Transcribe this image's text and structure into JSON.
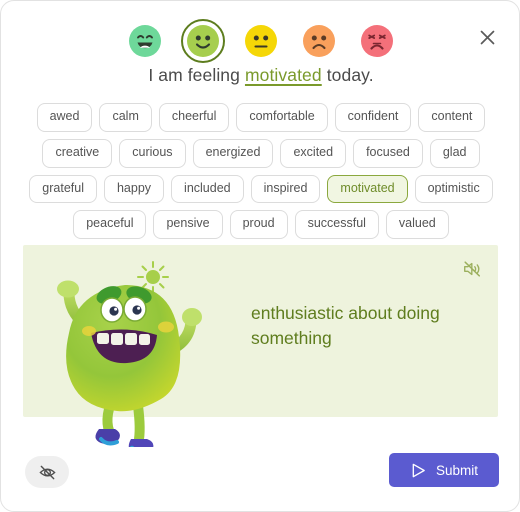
{
  "dialog": {
    "close_icon": "close-icon"
  },
  "mood_scale": {
    "options": [
      {
        "id": "very-happy",
        "icon": "grinning-face-icon",
        "face_color": "#6ed89a",
        "feature_color": "#2f3b2f",
        "selected": false,
        "label": "very happy"
      },
      {
        "id": "happy",
        "icon": "smiling-face-icon",
        "face_color": "#a6ce4e",
        "feature_color": "#2f3b2f",
        "selected": true,
        "label": "happy"
      },
      {
        "id": "neutral",
        "icon": "neutral-face-icon",
        "face_color": "#f5d707",
        "feature_color": "#3a3a28",
        "selected": false,
        "label": "neutral"
      },
      {
        "id": "sad",
        "icon": "frowning-face-icon",
        "face_color": "#f9a05c",
        "feature_color": "#5a3b26",
        "selected": false,
        "label": "sad"
      },
      {
        "id": "angry",
        "icon": "angry-face-icon",
        "face_color": "#f4707a",
        "feature_color": "#7a2630",
        "selected": false,
        "label": "angry"
      }
    ],
    "selected_ring_color": "#5d7d1e"
  },
  "sentence": {
    "prefix": "I am feeling ",
    "chosen_word": "motivated",
    "suffix": " today.",
    "chosen_word_color": "#7a9a2b"
  },
  "feelings": {
    "selected": "motivated",
    "chips": [
      "awed",
      "calm",
      "cheerful",
      "comfortable",
      "confident",
      "content",
      "creative",
      "curious",
      "energized",
      "excited",
      "focused",
      "glad",
      "grateful",
      "happy",
      "included",
      "inspired",
      "motivated",
      "optimistic",
      "peaceful",
      "pensive",
      "proud",
      "successful",
      "valued"
    ],
    "selected_bg": "#f1f6e2",
    "selected_border": "#8ba83e",
    "selected_text": "#6f8c2a"
  },
  "definition_panel": {
    "text": "enthusiastic about doing something",
    "background": "#eef3dd",
    "text_color": "#5f7d1e",
    "mute_icon": "speaker-muted-icon",
    "character_icon": "green-monster-character",
    "sparkle_icon": "sun-sparkle-icon"
  },
  "footer": {
    "hide_icon": "eye-off-icon",
    "submit_label": "Submit",
    "submit_icon": "send-icon",
    "submit_color": "#5b5bd0"
  }
}
